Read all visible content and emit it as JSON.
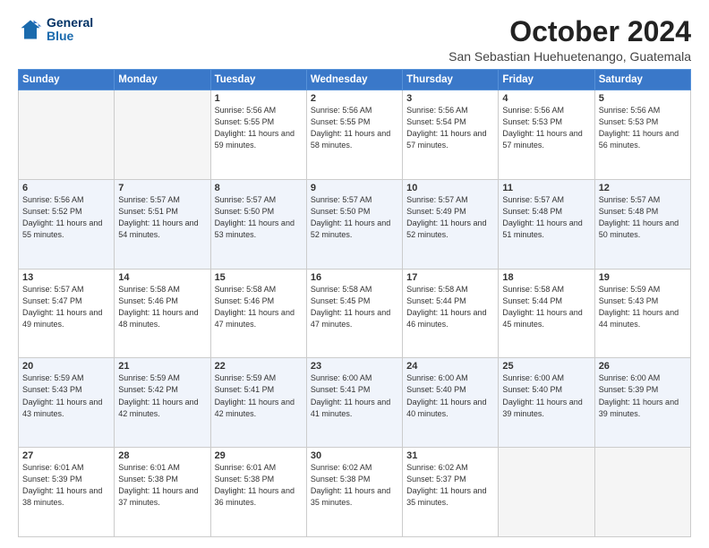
{
  "logo": {
    "line1": "General",
    "line2": "Blue"
  },
  "title": "October 2024",
  "location": "San Sebastian Huehuetenango, Guatemala",
  "weekdays": [
    "Sunday",
    "Monday",
    "Tuesday",
    "Wednesday",
    "Thursday",
    "Friday",
    "Saturday"
  ],
  "weeks": [
    [
      {
        "day": "",
        "info": ""
      },
      {
        "day": "",
        "info": ""
      },
      {
        "day": "1",
        "info": "Sunrise: 5:56 AM\nSunset: 5:55 PM\nDaylight: 11 hours and 59 minutes."
      },
      {
        "day": "2",
        "info": "Sunrise: 5:56 AM\nSunset: 5:55 PM\nDaylight: 11 hours and 58 minutes."
      },
      {
        "day": "3",
        "info": "Sunrise: 5:56 AM\nSunset: 5:54 PM\nDaylight: 11 hours and 57 minutes."
      },
      {
        "day": "4",
        "info": "Sunrise: 5:56 AM\nSunset: 5:53 PM\nDaylight: 11 hours and 57 minutes."
      },
      {
        "day": "5",
        "info": "Sunrise: 5:56 AM\nSunset: 5:53 PM\nDaylight: 11 hours and 56 minutes."
      }
    ],
    [
      {
        "day": "6",
        "info": "Sunrise: 5:56 AM\nSunset: 5:52 PM\nDaylight: 11 hours and 55 minutes."
      },
      {
        "day": "7",
        "info": "Sunrise: 5:57 AM\nSunset: 5:51 PM\nDaylight: 11 hours and 54 minutes."
      },
      {
        "day": "8",
        "info": "Sunrise: 5:57 AM\nSunset: 5:50 PM\nDaylight: 11 hours and 53 minutes."
      },
      {
        "day": "9",
        "info": "Sunrise: 5:57 AM\nSunset: 5:50 PM\nDaylight: 11 hours and 52 minutes."
      },
      {
        "day": "10",
        "info": "Sunrise: 5:57 AM\nSunset: 5:49 PM\nDaylight: 11 hours and 52 minutes."
      },
      {
        "day": "11",
        "info": "Sunrise: 5:57 AM\nSunset: 5:48 PM\nDaylight: 11 hours and 51 minutes."
      },
      {
        "day": "12",
        "info": "Sunrise: 5:57 AM\nSunset: 5:48 PM\nDaylight: 11 hours and 50 minutes."
      }
    ],
    [
      {
        "day": "13",
        "info": "Sunrise: 5:57 AM\nSunset: 5:47 PM\nDaylight: 11 hours and 49 minutes."
      },
      {
        "day": "14",
        "info": "Sunrise: 5:58 AM\nSunset: 5:46 PM\nDaylight: 11 hours and 48 minutes."
      },
      {
        "day": "15",
        "info": "Sunrise: 5:58 AM\nSunset: 5:46 PM\nDaylight: 11 hours and 47 minutes."
      },
      {
        "day": "16",
        "info": "Sunrise: 5:58 AM\nSunset: 5:45 PM\nDaylight: 11 hours and 47 minutes."
      },
      {
        "day": "17",
        "info": "Sunrise: 5:58 AM\nSunset: 5:44 PM\nDaylight: 11 hours and 46 minutes."
      },
      {
        "day": "18",
        "info": "Sunrise: 5:58 AM\nSunset: 5:44 PM\nDaylight: 11 hours and 45 minutes."
      },
      {
        "day": "19",
        "info": "Sunrise: 5:59 AM\nSunset: 5:43 PM\nDaylight: 11 hours and 44 minutes."
      }
    ],
    [
      {
        "day": "20",
        "info": "Sunrise: 5:59 AM\nSunset: 5:43 PM\nDaylight: 11 hours and 43 minutes."
      },
      {
        "day": "21",
        "info": "Sunrise: 5:59 AM\nSunset: 5:42 PM\nDaylight: 11 hours and 42 minutes."
      },
      {
        "day": "22",
        "info": "Sunrise: 5:59 AM\nSunset: 5:41 PM\nDaylight: 11 hours and 42 minutes."
      },
      {
        "day": "23",
        "info": "Sunrise: 6:00 AM\nSunset: 5:41 PM\nDaylight: 11 hours and 41 minutes."
      },
      {
        "day": "24",
        "info": "Sunrise: 6:00 AM\nSunset: 5:40 PM\nDaylight: 11 hours and 40 minutes."
      },
      {
        "day": "25",
        "info": "Sunrise: 6:00 AM\nSunset: 5:40 PM\nDaylight: 11 hours and 39 minutes."
      },
      {
        "day": "26",
        "info": "Sunrise: 6:00 AM\nSunset: 5:39 PM\nDaylight: 11 hours and 39 minutes."
      }
    ],
    [
      {
        "day": "27",
        "info": "Sunrise: 6:01 AM\nSunset: 5:39 PM\nDaylight: 11 hours and 38 minutes."
      },
      {
        "day": "28",
        "info": "Sunrise: 6:01 AM\nSunset: 5:38 PM\nDaylight: 11 hours and 37 minutes."
      },
      {
        "day": "29",
        "info": "Sunrise: 6:01 AM\nSunset: 5:38 PM\nDaylight: 11 hours and 36 minutes."
      },
      {
        "day": "30",
        "info": "Sunrise: 6:02 AM\nSunset: 5:38 PM\nDaylight: 11 hours and 35 minutes."
      },
      {
        "day": "31",
        "info": "Sunrise: 6:02 AM\nSunset: 5:37 PM\nDaylight: 11 hours and 35 minutes."
      },
      {
        "day": "",
        "info": ""
      },
      {
        "day": "",
        "info": ""
      }
    ]
  ]
}
